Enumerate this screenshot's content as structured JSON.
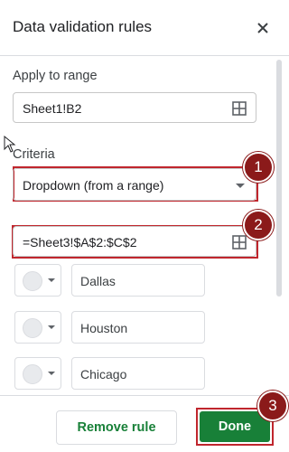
{
  "dialog": {
    "title": "Data validation rules"
  },
  "range": {
    "label": "Apply to range",
    "value": "Sheet1!B2"
  },
  "criteria": {
    "label": "Criteria",
    "selected": "Dropdown (from a range)",
    "formula": "=Sheet3!$A$2:$C$2"
  },
  "items": [
    {
      "value": "Dallas"
    },
    {
      "value": "Houston"
    },
    {
      "value": "Chicago"
    }
  ],
  "footer": {
    "remove_label": "Remove rule",
    "done_label": "Done"
  },
  "annotations": {
    "badge1": "1",
    "badge2": "2",
    "badge3": "3"
  },
  "colors": {
    "accent_green": "#188038",
    "annotation_red": "#c0262d",
    "badge_dark_red": "#8b1a1a"
  }
}
